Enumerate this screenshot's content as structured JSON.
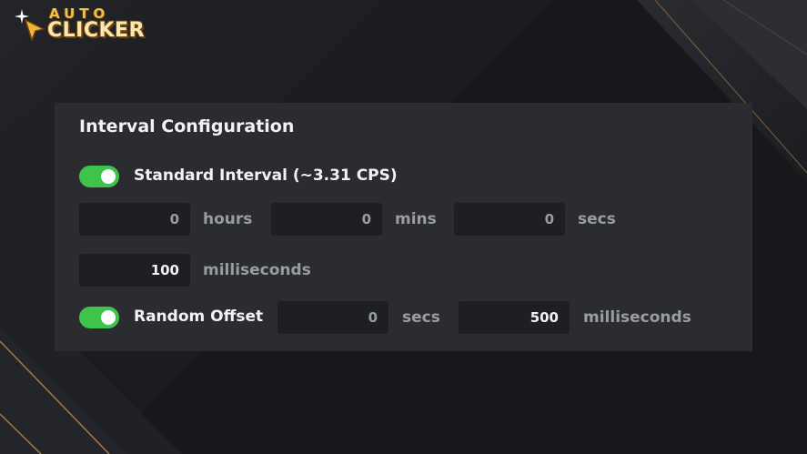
{
  "logo": {
    "word_top": "AUTO",
    "word_bottom": "CLICKER"
  },
  "panel": {
    "title": "Interval Configuration",
    "standard_interval": {
      "enabled": true,
      "label": "Standard Interval (~3.31 CPS)",
      "hours_value": "0",
      "hours_unit": "hours",
      "mins_value": "0",
      "mins_unit": "mins",
      "secs_value": "0",
      "secs_unit": "secs",
      "ms_value": "100",
      "ms_unit": "milliseconds"
    },
    "random_offset": {
      "enabled": true,
      "label": "Random Offset",
      "secs_value": "0",
      "secs_unit": "secs",
      "ms_value": "500",
      "ms_unit": "milliseconds"
    }
  },
  "colors": {
    "accent_toggle": "#3ec44a",
    "panel_bg": "#2b2c30",
    "field_bg": "#1e1f22",
    "gold_accent": "#b8894a"
  }
}
